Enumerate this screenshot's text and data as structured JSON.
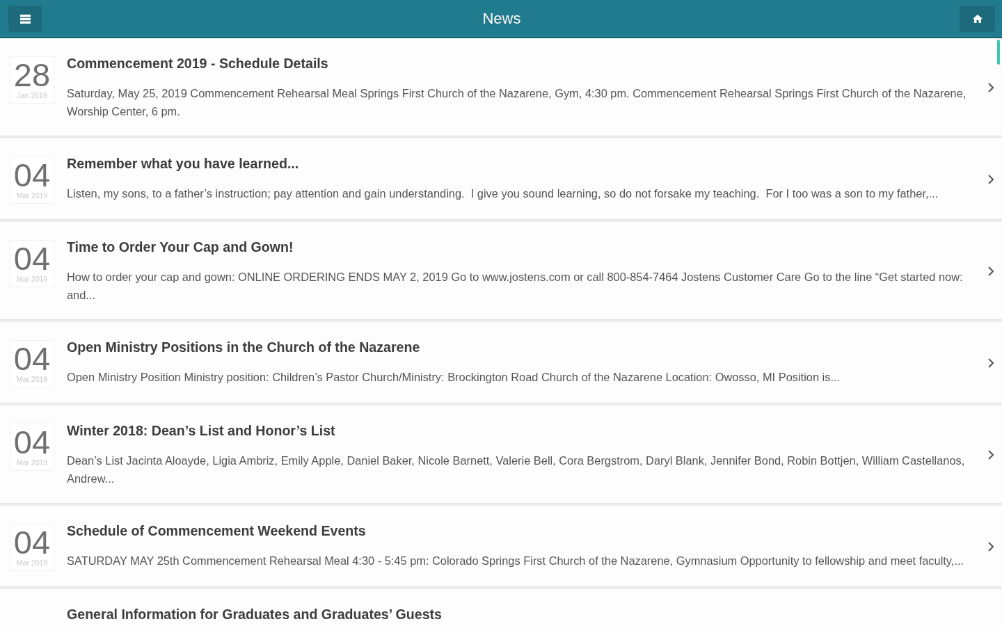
{
  "header": {
    "title": "News"
  },
  "news": [
    {
      "day": "28",
      "month_year": "Jan 2019",
      "title": "Commencement 2019 - Schedule Details",
      "summary": "Saturday, May 25, 2019 Commencement Rehearsal Meal Springs First Church of the Nazarene, Gym, 4:30 pm. Commencement Rehearsal Springs First Church of the Nazarene, Worship Center, 6 pm."
    },
    {
      "day": "04",
      "month_year": "Mar 2019",
      "title": "Remember what you have learned...",
      "summary": "Listen, my sons, to a father’s instruction; pay attention and gain understanding.  I give you sound learning, so do not forsake my teaching.  For I too was a son to my father,..."
    },
    {
      "day": "04",
      "month_year": "Mar 2019",
      "title": "Time to Order Your Cap and Gown!",
      "summary": "How to order your cap and gown: ONLINE ORDERING ENDS MAY 2, 2019 Go to www.jostens.com or call 800-854-7464 Jostens Customer Care Go to the line “Get started now: and..."
    },
    {
      "day": "04",
      "month_year": "Mar 2019",
      "title": "Open Ministry Positions in the Church of the Nazarene",
      "summary": "Open Ministry Position Ministry position: Children’s Pastor Church/Ministry: Brockington Road Church of the Nazarene Location: Owosso, MI Position is..."
    },
    {
      "day": "04",
      "month_year": "Mar 2019",
      "title": "Winter 2018: Dean’s List and Honor’s List",
      "summary": "Dean’s List Jacinta Aloayde, Ligia Ambriz, Emily Apple, Daniel Baker, Nicole Barnett, Valerie Bell, Cora Bergstrom, Daryl Blank, Jennifer Bond, Robin Bottjen, William Castellanos, Andrew..."
    },
    {
      "day": "04",
      "month_year": "Mar 2019",
      "title": "Schedule of Commencement Weekend Events",
      "summary": "SATURDAY MAY 25th Commencement Rehearsal Meal 4:30 - 5:45 pm: Colorado Springs First Church of the Nazarene, Gymnasium Opportunity to fellowship and meet faculty,..."
    },
    {
      "title": "General Information for Graduates and Graduates’ Guests"
    }
  ]
}
